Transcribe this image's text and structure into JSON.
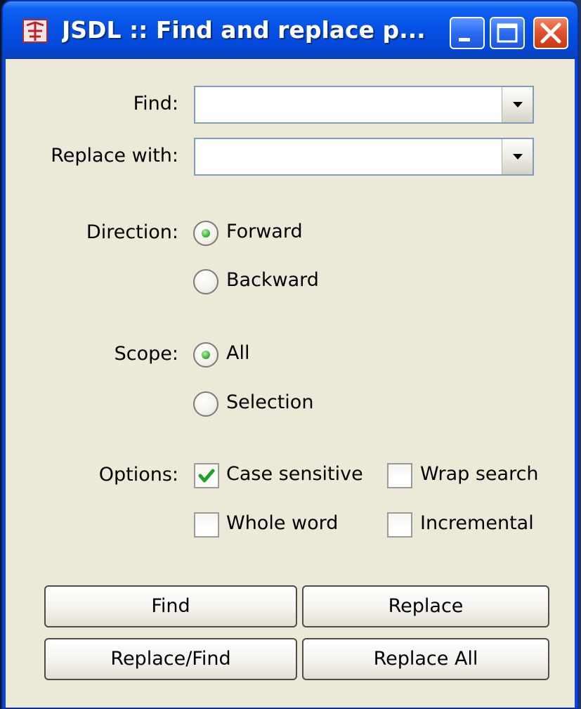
{
  "window": {
    "title": "JSDL :: Find and replace p..."
  },
  "find": {
    "label": "Find:",
    "value": ""
  },
  "replace": {
    "label": "Replace with:",
    "value": ""
  },
  "direction": {
    "label": "Direction:",
    "options": [
      {
        "label": "Forward",
        "selected": true
      },
      {
        "label": "Backward",
        "selected": false
      }
    ]
  },
  "scope": {
    "label": "Scope:",
    "options": [
      {
        "label": "All",
        "selected": true
      },
      {
        "label": "Selection",
        "selected": false
      }
    ]
  },
  "options": {
    "label": "Options:",
    "items": [
      {
        "label": "Case sensitive",
        "checked": true
      },
      {
        "label": "Wrap search",
        "checked": false
      },
      {
        "label": "Whole word",
        "checked": false
      },
      {
        "label": "Incremental",
        "checked": false
      }
    ]
  },
  "buttons": {
    "find": "Find",
    "replace": "Replace",
    "replace_find": "Replace/Find",
    "replace_all": "Replace All"
  },
  "colors": {
    "titlebar": "#0551e6",
    "client_bg": "#ece9d8",
    "radio_dot": "#3fb33a",
    "checkmark": "#21a121"
  }
}
